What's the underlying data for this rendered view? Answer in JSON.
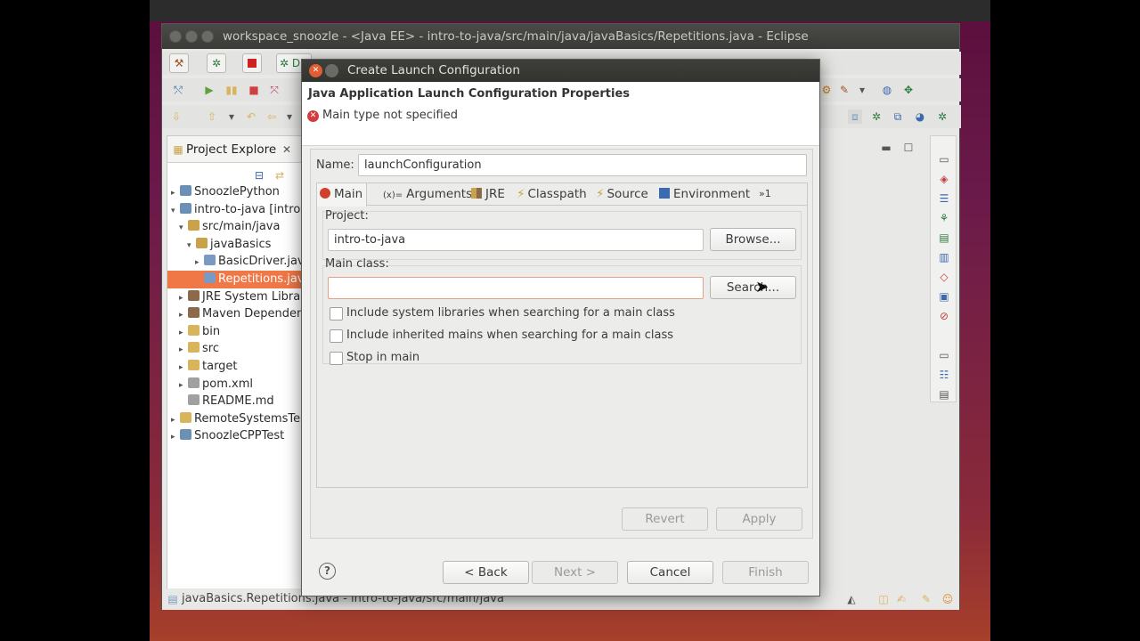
{
  "eclipse": {
    "title": "workspace_snoozle - <Java EE> - intro-to-java/src/main/java/javaBasics/Repetitions.java - Eclipse",
    "status_bar": "javaBasics.Repetitions.java - intro-to-java/src/main/java",
    "toolbar_partial_label": "D"
  },
  "project_explorer": {
    "title": "Project Explore",
    "items": [
      {
        "label": "SnoozlePython",
        "indent": 0,
        "arrow": "▸",
        "icon": "project-icon",
        "color": "#6b8fb5"
      },
      {
        "label": "intro-to-java [intro",
        "indent": 0,
        "arrow": "▾",
        "icon": "java-project-icon",
        "color": "#6b8fb5"
      },
      {
        "label": "src/main/java",
        "indent": 1,
        "arrow": "▾",
        "icon": "source-folder-icon",
        "color": "#c9a24a"
      },
      {
        "label": "javaBasics",
        "indent": 2,
        "arrow": "▾",
        "icon": "package-icon",
        "color": "#c9a24a"
      },
      {
        "label": "BasicDriver.java",
        "indent": 3,
        "arrow": "▸",
        "icon": "java-file-icon",
        "color": "#7a9ac4"
      },
      {
        "label": "Repetitions.java",
        "indent": 3,
        "arrow": "",
        "icon": "java-file-icon",
        "color": "#7a9ac4",
        "selected": true
      },
      {
        "label": "JRE System Library",
        "indent": 1,
        "arrow": "▸",
        "icon": "library-icon",
        "color": "#8a6a4a"
      },
      {
        "label": "Maven Dependenc",
        "indent": 1,
        "arrow": "▸",
        "icon": "library-icon",
        "color": "#8a6a4a"
      },
      {
        "label": "bin",
        "indent": 1,
        "arrow": "▸",
        "icon": "folder-icon",
        "color": "#d8b45a"
      },
      {
        "label": "src",
        "indent": 1,
        "arrow": "▸",
        "icon": "folder-icon",
        "color": "#d8b45a"
      },
      {
        "label": "target",
        "indent": 1,
        "arrow": "▸",
        "icon": "folder-icon",
        "color": "#d8b45a"
      },
      {
        "label": "pom.xml",
        "indent": 1,
        "arrow": "▸",
        "icon": "xml-file-icon",
        "color": "#a0a0a0"
      },
      {
        "label": "README.md",
        "indent": 1,
        "arrow": "",
        "icon": "md-file-icon",
        "color": "#a0a0a0"
      },
      {
        "label": "RemoteSystemsTem",
        "indent": 0,
        "arrow": "▸",
        "icon": "folder-icon",
        "color": "#d8b45a"
      },
      {
        "label": "SnoozleCPPTest",
        "indent": 0,
        "arrow": "▸",
        "icon": "project-icon",
        "color": "#6b8fb5"
      }
    ]
  },
  "dialog": {
    "title": "Create Launch Configuration",
    "header_title": "Java Application Launch Configuration Properties",
    "error_message": "Main type not specified",
    "name_label": "Name:",
    "name_value": "launchConfiguration",
    "tabs": [
      {
        "label": "Main",
        "icon": "main-tab-icon",
        "active": true
      },
      {
        "label": "Arguments",
        "icon": "arguments-tab-icon"
      },
      {
        "label": "JRE",
        "icon": "jre-tab-icon"
      },
      {
        "label": "Classpath",
        "icon": "classpath-tab-icon"
      },
      {
        "label": "Source",
        "icon": "source-tab-icon"
      },
      {
        "label": "Environment",
        "icon": "environment-tab-icon"
      },
      {
        "label": "»1",
        "icon": ""
      }
    ],
    "project_label": "Project:",
    "project_value": "intro-to-java",
    "browse_label": "Browse...",
    "main_class_label": "Main class:",
    "main_class_value": "",
    "search_label": "Search...",
    "options": [
      {
        "label": "Include system libraries when searching for a main class",
        "checked": false
      },
      {
        "label": "Include inherited mains when searching for a main class",
        "checked": false
      },
      {
        "label": "Stop in main",
        "checked": false
      }
    ],
    "revert_label": "Revert",
    "apply_label": "Apply",
    "back_label": "< Back",
    "next_label": "Next >",
    "cancel_label": "Cancel",
    "finish_label": "Finish"
  }
}
